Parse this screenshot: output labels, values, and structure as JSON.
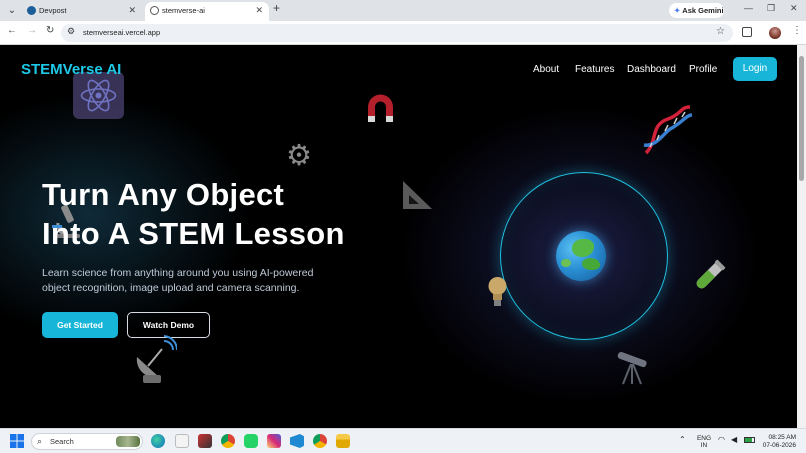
{
  "browser": {
    "tabs": [
      {
        "title": "Devpost",
        "active": false
      },
      {
        "title": "stemverse-ai",
        "active": true
      }
    ],
    "url": "stemverseai.vercel.app",
    "ask_gemini": "Ask Gemini"
  },
  "site": {
    "brand": "STEMVerse AI",
    "nav": [
      "About",
      "Features",
      "Dashboard",
      "Profile"
    ],
    "login_label": "Login",
    "headline_line1": "Turn Any Object",
    "headline_line2": "Into A STEM Lesson",
    "subtitle_line1": "Learn science from anything around you using AI-powered",
    "subtitle_line2": "object recognition, image upload and camera scanning.",
    "get_started_label": "Get Started",
    "watch_demo_label": "Watch Demo",
    "decorations": [
      "atom-icon",
      "magnet-icon",
      "gear-icon",
      "dna-icon",
      "set-square-icon",
      "microscope-icon",
      "globe-icon",
      "lightbulb-icon",
      "test-tube-icon",
      "satellite-dish-icon",
      "telescope-icon"
    ],
    "accent_color": "#17b6d9"
  },
  "taskbar": {
    "search_placeholder": "Search",
    "apps": [
      "windows-start",
      "edge",
      "files-app",
      "photos-app",
      "chrome",
      "whatsapp",
      "instagram",
      "vscode",
      "chrome-profile",
      "file-explorer"
    ],
    "lang_line1": "ENG",
    "lang_line2": "IN",
    "time": "08:25 AM",
    "date": "07-06-2026"
  }
}
